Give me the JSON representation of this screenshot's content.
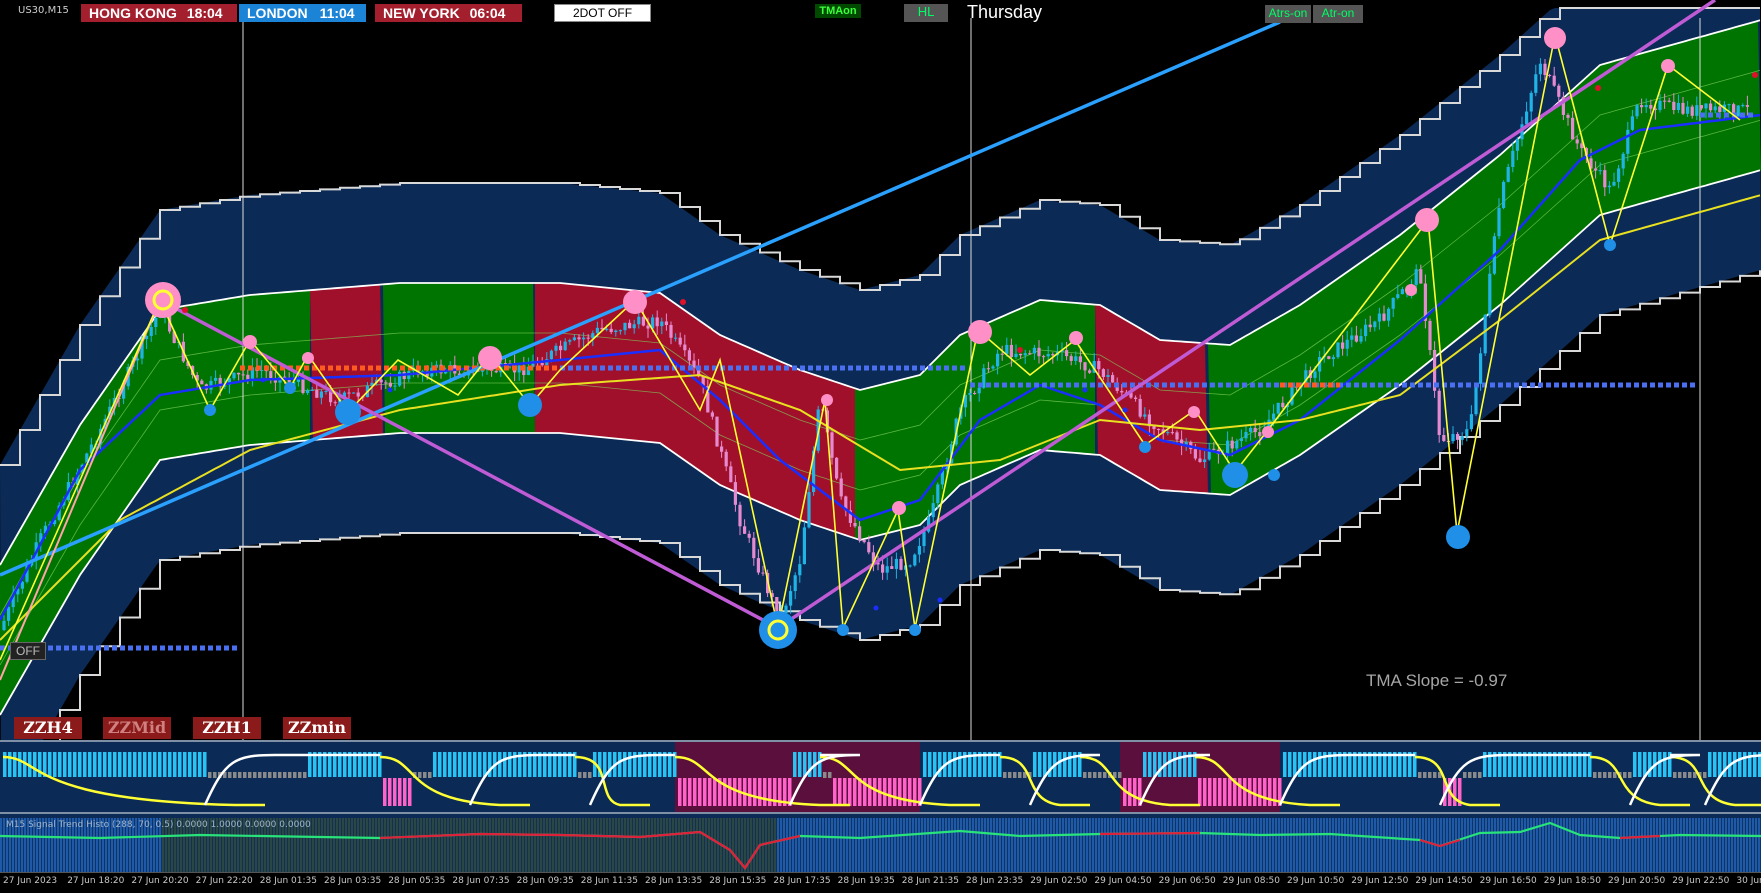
{
  "symbol": "US30,M15",
  "sessions": [
    {
      "name": "HONG KONG",
      "time": "18:04",
      "color": "#a31f2e"
    },
    {
      "name": "LONDON",
      "time": "11:04",
      "color": "#1c84d6"
    },
    {
      "name": "NEW YORK",
      "time": "06:04",
      "color": "#a31f2e"
    }
  ],
  "buttons": {
    "two_dot": "2DOT OFF",
    "tma_on": "TMAon",
    "hl": "HL",
    "day": "Thursday",
    "atrs_on": "Atrs-on",
    "atr_on": "Atr-on",
    "off": "OFF"
  },
  "zz_buttons": [
    "ZZH4",
    "ZZMid",
    "ZZH1",
    "ZZmin"
  ],
  "tma_slope": "TMA Slope = -0.97",
  "sub2_label": "M15 Signal Trend Histo (288, 70, 0.5)  0.0000 1.0000 0.0000 0.0000",
  "time_axis": [
    "27 Jun 2023",
    "27 Jun 18:20",
    "27 Jun 20:20",
    "27 Jun 22:20",
    "28 Jun 01:35",
    "28 Jun 03:35",
    "28 Jun 05:35",
    "28 Jun 07:35",
    "28 Jun 09:35",
    "28 Jun 11:35",
    "28 Jun 13:35",
    "28 Jun 15:35",
    "28 Jun 17:35",
    "28 Jun 19:35",
    "28 Jun 21:35",
    "28 Jun 23:35",
    "29 Jun 02:50",
    "29 Jun 04:50",
    "29 Jun 06:50",
    "29 Jun 08:50",
    "29 Jun 10:50",
    "29 Jun 12:50",
    "29 Jun 14:50",
    "29 Jun 16:50",
    "29 Jun 18:50",
    "29 Jun 20:50",
    "29 Jun 22:50",
    "30 Jun"
  ],
  "colors": {
    "channel": "#0b2a55",
    "band_up": "#007400",
    "band_down": "#a0102b",
    "bull": "#1fb3e6",
    "bear": "#e58ad0",
    "zigzag": "#ffff33",
    "trend_magenta": "#c05bd6",
    "trend_blue": "#2aa0ff"
  }
}
